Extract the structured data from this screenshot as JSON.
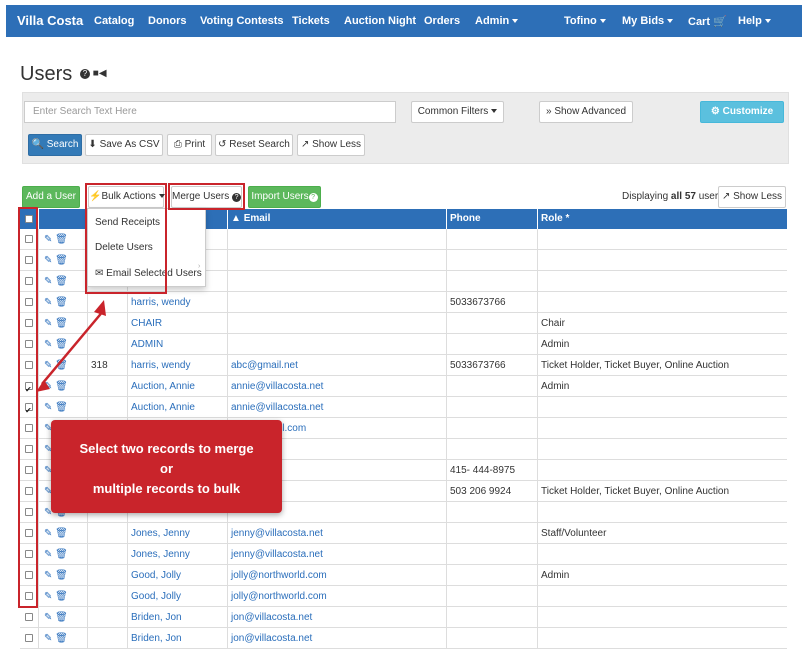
{
  "navbar": {
    "brand": "Villa Costa",
    "items": [
      "Catalog",
      "Donors",
      "Voting Contests",
      "Tickets",
      "Auction Night",
      "Orders",
      "Admin"
    ],
    "right_items": [
      "Tofino",
      "My Bids",
      "Cart",
      "Help"
    ],
    "accent_color": "#2d6fb7"
  },
  "page": {
    "title": "Users",
    "title_icons": [
      "help-icon",
      "video-camera-icon"
    ]
  },
  "filters": {
    "search_placeholder": "Enter Search Text Here",
    "common_filters_label": "Common Filters",
    "show_advanced_label": "Show Advanced",
    "customize_label": "Customize",
    "search_label": "Search",
    "save_csv_label": "Save As CSV",
    "print_label": "Print",
    "reset_label": "Reset Search",
    "show_less_label": "Show Less"
  },
  "toolbar": {
    "add_user_label": "Add a User",
    "bulk_actions_label": "Bulk Actions",
    "merge_users_label": "Merge Users",
    "import_users_label": "Import Users",
    "display_prefix": "Displaying",
    "display_all": "all",
    "display_count": "57",
    "display_suffix": "users",
    "show_less_label": "Show Less"
  },
  "bulk_menu": {
    "items": [
      "Send Receipts",
      "Delete Users",
      "Email Selected Users"
    ]
  },
  "table": {
    "columns": [
      "",
      "",
      "",
      "Email",
      "Phone",
      "Role *"
    ],
    "email_sort_indicator": "▲",
    "rows": [
      {
        "checked": false,
        "id": "",
        "name": "",
        "email": "",
        "phone": "",
        "role": ""
      },
      {
        "checked": false,
        "id": "",
        "name": "",
        "email": "",
        "phone": "",
        "role": ""
      },
      {
        "checked": false,
        "id": "",
        "name": "",
        "email": "",
        "phone": "",
        "role": ""
      },
      {
        "checked": false,
        "id": "",
        "name": "harris, wendy",
        "email": "",
        "phone": "5033673766",
        "role": ""
      },
      {
        "checked": false,
        "id": "",
        "name": "CHAIR",
        "email": "",
        "phone": "",
        "role": "Chair"
      },
      {
        "checked": false,
        "id": "",
        "name": "ADMIN",
        "email": "",
        "phone": "",
        "role": "Admin"
      },
      {
        "checked": false,
        "id": "318",
        "name": "harris, wendy",
        "email": "abc@gmail.net",
        "phone": "5033673766",
        "role": "Ticket Holder, Ticket Buyer, Online Auction"
      },
      {
        "checked": true,
        "id": "",
        "name": "Auction, Annie",
        "email": "annie@villacosta.net",
        "phone": "",
        "role": "Admin"
      },
      {
        "checked": true,
        "id": "",
        "name": "Auction, Annie",
        "email": "annie@villacosta.net",
        "phone": "",
        "role": ""
      },
      {
        "checked": false,
        "id": "",
        "name": "",
        "email": "sher@gmail.com",
        "phone": "",
        "role": ""
      },
      {
        "checked": false,
        "id": "",
        "name": "",
        "email": "gmail.com",
        "phone": "",
        "role": ""
      },
      {
        "checked": false,
        "id": "",
        "name": "",
        "email": "et",
        "phone": "415- 444-8975",
        "role": ""
      },
      {
        "checked": false,
        "id": "",
        "name": "",
        "email": "com",
        "phone": "503 206 9924",
        "role": "Ticket Holder, Ticket Buyer, Online Auction"
      },
      {
        "checked": false,
        "id": "",
        "name": "",
        "email": "",
        "phone": "",
        "role": ""
      },
      {
        "checked": false,
        "id": "",
        "name": "Jones, Jenny",
        "email": "jenny@villacosta.net",
        "phone": "",
        "role": "Staff/Volunteer"
      },
      {
        "checked": false,
        "id": "",
        "name": "Jones, Jenny",
        "email": "jenny@villacosta.net",
        "phone": "",
        "role": ""
      },
      {
        "checked": false,
        "id": "",
        "name": "Good, Jolly",
        "email": "jolly@northworld.com",
        "phone": "",
        "role": "Admin"
      },
      {
        "checked": false,
        "id": "",
        "name": "Good, Jolly",
        "email": "jolly@northworld.com",
        "phone": "",
        "role": ""
      },
      {
        "checked": false,
        "id": "",
        "name": "Briden, Jon",
        "email": "jon@villacosta.net",
        "phone": "",
        "role": ""
      },
      {
        "checked": false,
        "id": "",
        "name": "Briden, Jon",
        "email": "jon@villacosta.net",
        "phone": "",
        "role": ""
      }
    ]
  },
  "callout": {
    "line1": "Select two records to merge",
    "line2": "or",
    "line3": "multiple records to bulk",
    "color": "#c9242b"
  }
}
